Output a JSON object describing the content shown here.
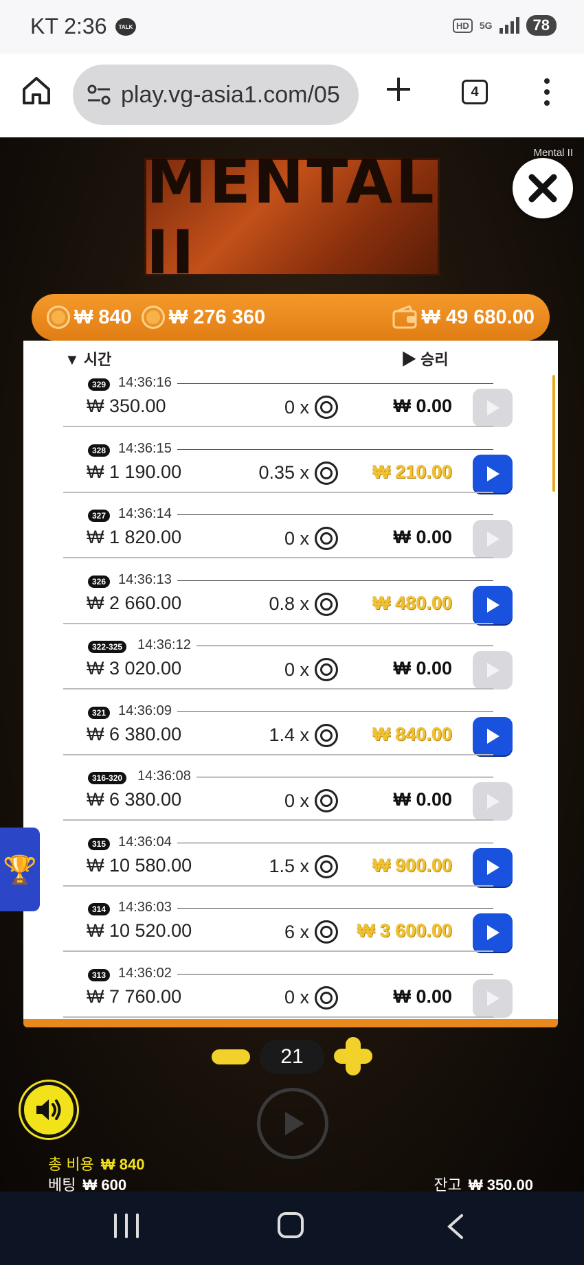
{
  "status_bar": {
    "carrier_time": "KT 2:36",
    "talk_badge": "TALK",
    "hd": "HD",
    "network": "5G",
    "battery": "78"
  },
  "browser": {
    "url": "play.vg-asia1.com/05",
    "tab_count": "4"
  },
  "game": {
    "name": "Mental II",
    "logo_text": "MENTAL II",
    "header": {
      "total_cost": "₩ 840",
      "total_win": "₩ 276 360",
      "balance": "₩ 49 680.00"
    },
    "columns": {
      "time": "시간",
      "win": "승리"
    },
    "rows": [
      {
        "round": "329",
        "time": "14:36:16",
        "bet": "₩ 350.00",
        "multiplier": "0 x",
        "win": "₩ 0.00",
        "win_highlight": false
      },
      {
        "round": "328",
        "time": "14:36:15",
        "bet": "₩ 1 190.00",
        "multiplier": "0.35 x",
        "win": "₩ 210.00",
        "win_highlight": true
      },
      {
        "round": "327",
        "time": "14:36:14",
        "bet": "₩ 1 820.00",
        "multiplier": "0 x",
        "win": "₩ 0.00",
        "win_highlight": false
      },
      {
        "round": "326",
        "time": "14:36:13",
        "bet": "₩ 2 660.00",
        "multiplier": "0.8 x",
        "win": "₩ 480.00",
        "win_highlight": true
      },
      {
        "round": "322-325",
        "time": "14:36:12",
        "bet": "₩ 3 020.00",
        "multiplier": "0 x",
        "win": "₩ 0.00",
        "win_highlight": false
      },
      {
        "round": "321",
        "time": "14:36:09",
        "bet": "₩ 6 380.00",
        "multiplier": "1.4 x",
        "win": "₩ 840.00",
        "win_highlight": true
      },
      {
        "round": "316-320",
        "time": "14:36:08",
        "bet": "₩ 6 380.00",
        "multiplier": "0 x",
        "win": "₩ 0.00",
        "win_highlight": false
      },
      {
        "round": "315",
        "time": "14:36:04",
        "bet": "₩ 10 580.00",
        "multiplier": "1.5 x",
        "win": "₩ 900.00",
        "win_highlight": true
      },
      {
        "round": "314",
        "time": "14:36:03",
        "bet": "₩ 10 520.00",
        "multiplier": "6 x",
        "win": "₩ 3 600.00",
        "win_highlight": true
      },
      {
        "round": "313",
        "time": "14:36:02",
        "bet": "₩ 7 760.00",
        "multiplier": "0 x",
        "win": "₩ 0.00",
        "win_highlight": false
      }
    ],
    "controls": {
      "count": "21"
    },
    "footer": {
      "total_cost_label": "총 비용",
      "total_cost_value": "₩ 840",
      "bet_label": "베팅",
      "bet_value": "₩ 600",
      "balance_label": "잔고",
      "balance_value": "₩ 350.00"
    }
  },
  "colors": {
    "accent_orange": "#e8891e",
    "replay_blue": "#1a52e0",
    "win_gold": "#f2c230",
    "control_yellow": "#f2d22a"
  }
}
